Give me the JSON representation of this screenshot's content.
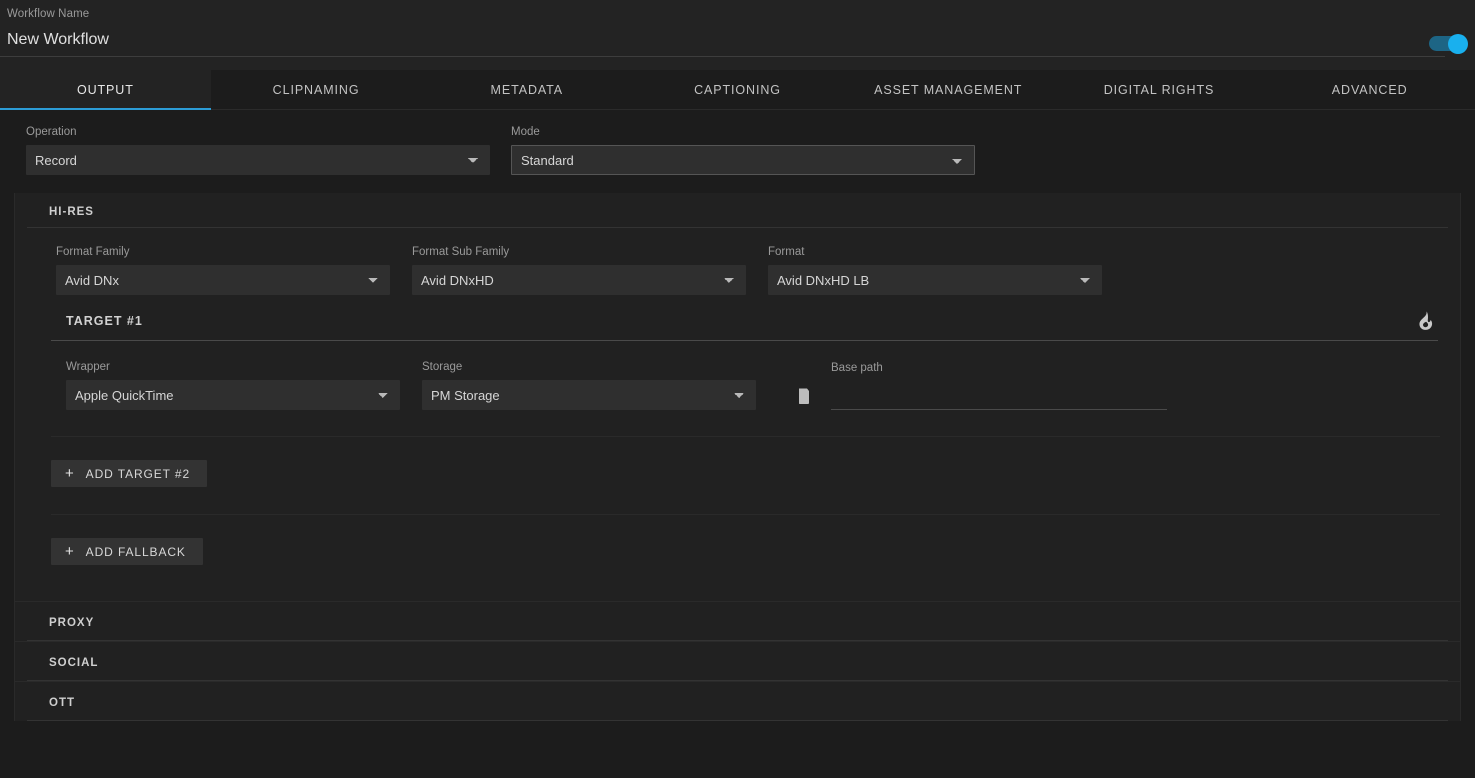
{
  "header": {
    "workflow_name_label": "Workflow Name",
    "workflow_name": "New Workflow",
    "toggle_state": "on",
    "accent_color": "#19b0ee"
  },
  "tabs": [
    {
      "label": "OUTPUT",
      "active": true
    },
    {
      "label": "CLIPNAMING",
      "active": false
    },
    {
      "label": "METADATA",
      "active": false
    },
    {
      "label": "CAPTIONING",
      "active": false
    },
    {
      "label": "ASSET MANAGEMENT",
      "active": false
    },
    {
      "label": "DIGITAL RIGHTS",
      "active": false
    },
    {
      "label": "ADVANCED",
      "active": false
    }
  ],
  "top_fields": {
    "operation": {
      "label": "Operation",
      "value": "Record"
    },
    "mode": {
      "label": "Mode",
      "value": "Standard"
    }
  },
  "hires": {
    "title": "HI-RES",
    "format_family": {
      "label": "Format Family",
      "value": "Avid DNx"
    },
    "format_sub_family": {
      "label": "Format Sub Family",
      "value": "Avid DNxHD"
    },
    "format": {
      "label": "Format",
      "value": "Avid DNxHD LB"
    },
    "target": {
      "title": "TARGET #1",
      "flame_icon": "flame-icon",
      "wrapper": {
        "label": "Wrapper",
        "value": "Apple QuickTime"
      },
      "storage": {
        "label": "Storage",
        "value": "PM Storage"
      },
      "base_path": {
        "label": "Base path",
        "value": "",
        "placeholder": "",
        "icon": "folder-icon"
      }
    },
    "add_target_button": "ADD TARGET #2",
    "add_fallback_button": "ADD FALLBACK",
    "plus_glyph": "+"
  },
  "sections": [
    {
      "title": "PROXY"
    },
    {
      "title": "SOCIAL"
    },
    {
      "title": "OTT"
    }
  ]
}
